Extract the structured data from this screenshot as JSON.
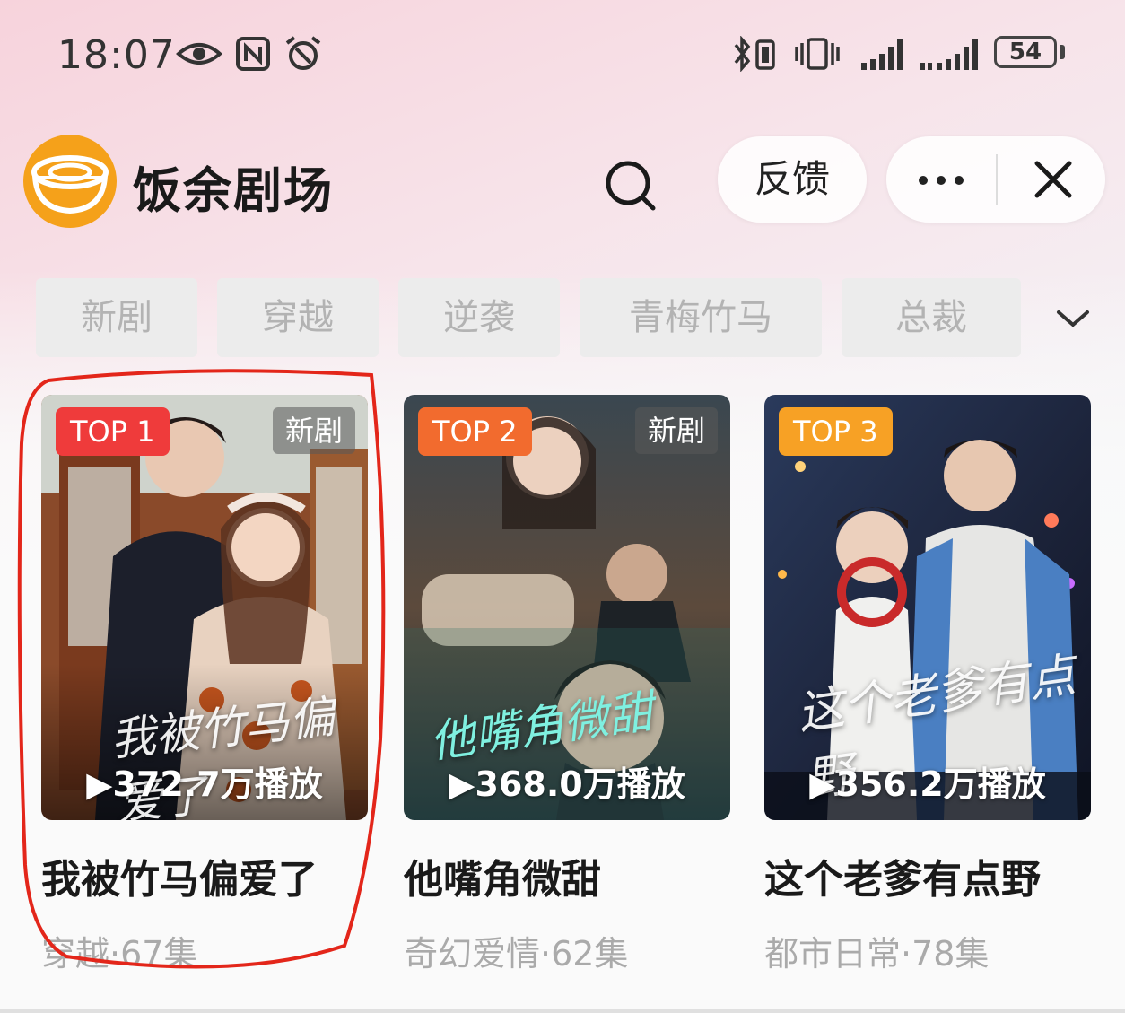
{
  "status_bar": {
    "time": "18:07",
    "battery": "54",
    "icons": [
      "eye-icon",
      "nfc-icon",
      "alarm-icon",
      "bluetooth-icon",
      "vibrate-icon",
      "signal-icon",
      "signal-icon"
    ]
  },
  "header": {
    "app_name": "饭余剧场",
    "feedback_label": "反馈",
    "icons": [
      "app-logo",
      "search-icon",
      "more-icon",
      "close-icon"
    ]
  },
  "categories": [
    "新剧",
    "穿越",
    "逆袭",
    "青梅竹马",
    "总裁"
  ],
  "dramas": [
    {
      "rank": "TOP 1",
      "rank_color": "#ef3b3b",
      "new_label": "新剧",
      "plays": "372.7万播放",
      "title": "我被竹马偏爱了",
      "meta": "穿越·67集",
      "poster_text": "我被竹马偏爱了"
    },
    {
      "rank": "TOP 2",
      "rank_color": "#f26b2e",
      "new_label": "新剧",
      "plays": "368.0万播放",
      "title": "他嘴角微甜",
      "meta": "奇幻爱情·62集",
      "poster_text": "他嘴角微甜"
    },
    {
      "rank": "TOP 3",
      "rank_color": "#f7a125",
      "plays": "356.2万播放",
      "title": "这个老爹有点野",
      "meta": "都市日常·78集",
      "poster_text": "这个老爹有点野"
    }
  ],
  "colors": {
    "highlight": "#e3261a",
    "logo_orange": "#f5a11a"
  }
}
